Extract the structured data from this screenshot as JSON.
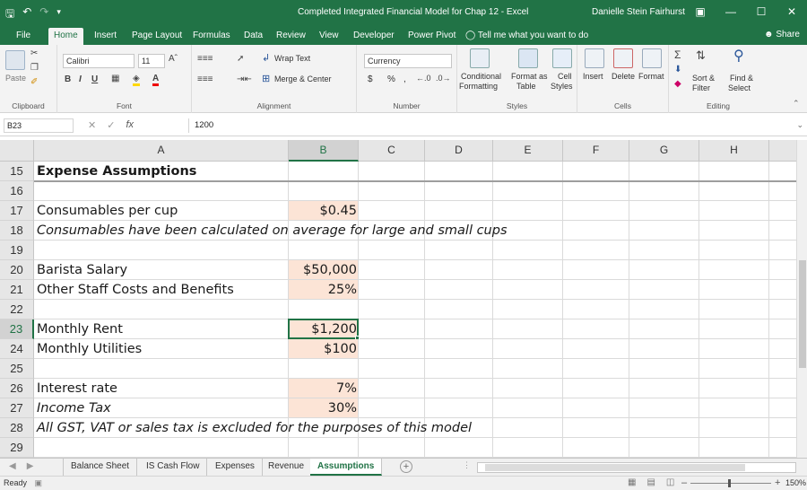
{
  "window": {
    "title": "Completed Integrated Financial Model for Chap 12 - Excel",
    "user": "Danielle Stein Fairhurst"
  },
  "ribbon_tabs": [
    "File",
    "Home",
    "Insert",
    "Page Layout",
    "Formulas",
    "Data",
    "Review",
    "View",
    "Developer",
    "Power Pivot"
  ],
  "active_tab": "Home",
  "tell_me": "Tell me what you want to do",
  "share": "Share",
  "ribbon": {
    "clipboard": {
      "label": "Clipboard",
      "paste": "Paste"
    },
    "font": {
      "label": "Font",
      "family": "Calibri",
      "size": "11"
    },
    "alignment": {
      "label": "Alignment",
      "wrap": "Wrap Text",
      "merge": "Merge & Center"
    },
    "number": {
      "label": "Number",
      "format": "Currency",
      "currency_sym": "$",
      "percent": "%",
      "comma": ","
    },
    "styles": {
      "label": "Styles",
      "conditional": "Conditional",
      "formatting": "Formatting",
      "format_as": "Format as",
      "table": "Table",
      "cell": "Cell",
      "styles": "Styles"
    },
    "cells": {
      "label": "Cells",
      "insert": "Insert",
      "delete": "Delete",
      "format": "Format"
    },
    "editing": {
      "label": "Editing",
      "sort": "Sort &",
      "filter": "Filter",
      "find": "Find &",
      "select": "Select"
    }
  },
  "formula_bar": {
    "name_box": "B23",
    "fx": "fx",
    "value": "1200"
  },
  "columns": [
    "A",
    "B",
    "C",
    "D",
    "E",
    "F",
    "G",
    "H"
  ],
  "selected_column": "B",
  "rows": [
    {
      "num": "15",
      "a": "Expense Assumptions",
      "b": "",
      "style": "bold"
    },
    {
      "num": "16",
      "a": "",
      "b": ""
    },
    {
      "num": "17",
      "a": "Consumables per cup",
      "b": "$0.45",
      "input": true
    },
    {
      "num": "18",
      "a": "Consumables have been calculated on average for large and small cups",
      "b": "",
      "style": "italic"
    },
    {
      "num": "19",
      "a": "",
      "b": ""
    },
    {
      "num": "20",
      "a": "Barista Salary",
      "b": "$50,000",
      "input": true
    },
    {
      "num": "21",
      "a": "Other Staff Costs and Benefits",
      "b": "25%",
      "input": true
    },
    {
      "num": "22",
      "a": "",
      "b": ""
    },
    {
      "num": "23",
      "a": "Monthly Rent",
      "b": "$1,200",
      "input": true,
      "selected": true
    },
    {
      "num": "24",
      "a": "Monthly Utilities",
      "b": "$100",
      "input": true
    },
    {
      "num": "25",
      "a": "",
      "b": ""
    },
    {
      "num": "26",
      "a": "Interest rate",
      "b": "7%",
      "input": true
    },
    {
      "num": "27",
      "a": "Income Tax",
      "b": "30%",
      "input": true,
      "style": "italic-a"
    },
    {
      "num": "28",
      "a": "All GST, VAT or sales tax is excluded for the purposes of this model",
      "b": "",
      "style": "italic"
    },
    {
      "num": "29",
      "a": "",
      "b": ""
    }
  ],
  "sheets": [
    "Balance Sheet",
    "IS Cash Flow",
    "Expenses",
    "Revenue",
    "Assumptions"
  ],
  "active_sheet": "Assumptions",
  "status": {
    "ready": "Ready",
    "zoom": "150%"
  },
  "colors": {
    "excel_green": "#217346",
    "input_fill": "#fce4d6"
  }
}
